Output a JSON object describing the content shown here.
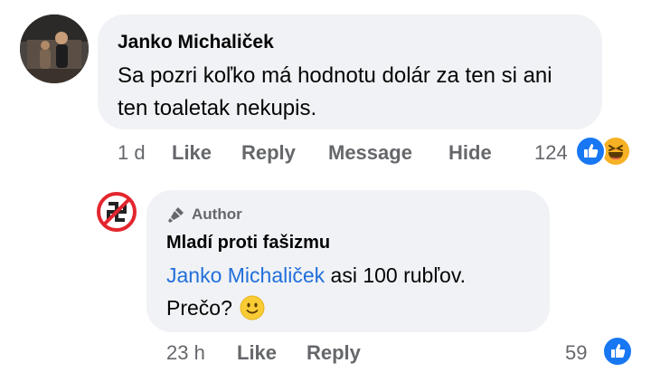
{
  "comment": {
    "author": "Janko Michaliček",
    "text": "Sa pozri koľko má hodnotu dolár za ten si ani ten toaletak nekupis.",
    "time": "1 d",
    "actions": [
      "Like",
      "Reply",
      "Message",
      "Hide"
    ],
    "reaction_count": "124",
    "reactions": [
      "like-icon",
      "haha-icon"
    ]
  },
  "reply": {
    "badge": "Author",
    "author": "Mladí proti fašizmu",
    "mention": "Janko Michaliček",
    "text": " asi 100 rubľov.",
    "text2": "Prečo?",
    "emoji": "slightly-smiling-face-icon",
    "time": "23 h",
    "actions": [
      "Like",
      "Reply"
    ],
    "reaction_count": "59",
    "reactions": [
      "like-icon"
    ]
  },
  "colors": {
    "bubble": "#f0f2f5",
    "meta_text": "#65676b",
    "mention": "#216fdb",
    "like_blue": "#1877f2",
    "haha_yellow": "#f7b125"
  }
}
